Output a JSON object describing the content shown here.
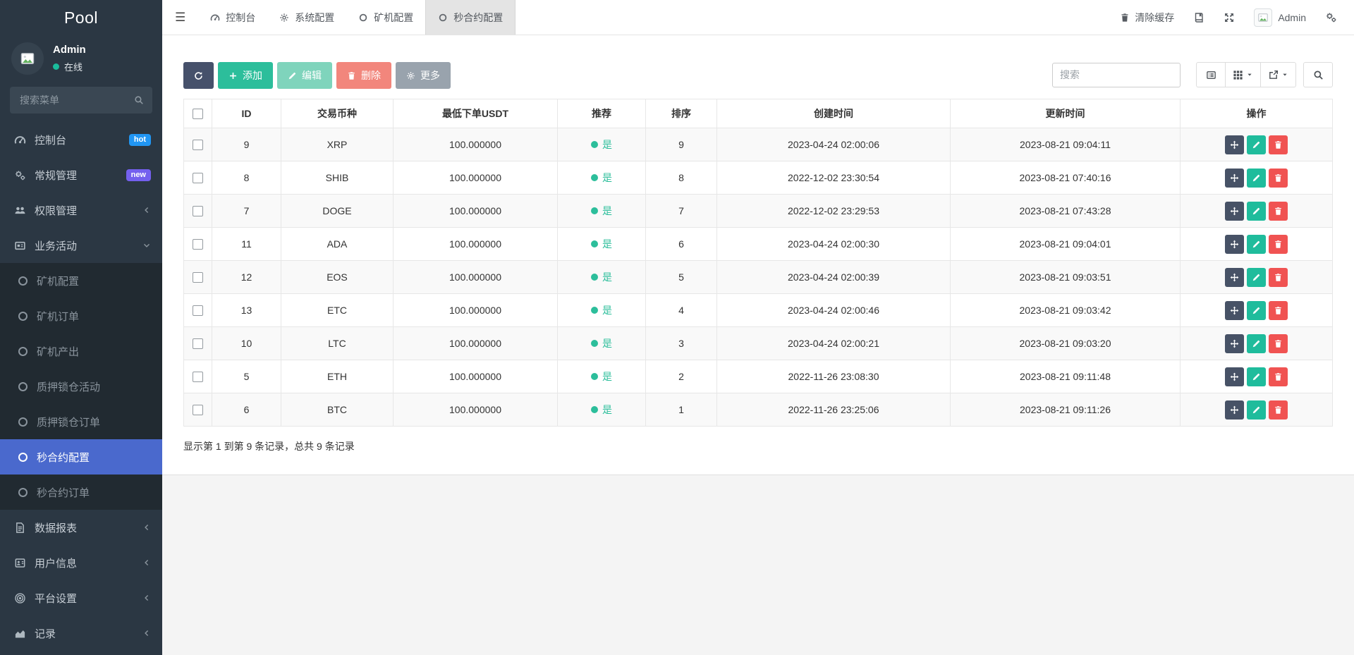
{
  "sidebar": {
    "logo": "Pool",
    "user": {
      "name": "Admin",
      "status": "在线",
      "status_color": "#1abc9c"
    },
    "search_placeholder": "搜索菜单",
    "menu_top": [
      {
        "label": "控制台",
        "icon": "gauge-icon",
        "badge": {
          "text": "hot",
          "color": "#2196f3"
        }
      },
      {
        "label": "常规管理",
        "icon": "cogs-icon",
        "badge": {
          "text": "new",
          "color": "#7460ee"
        }
      },
      {
        "label": "权限管理",
        "icon": "users-icon",
        "chevron": "left"
      },
      {
        "label": "业务活动",
        "icon": "newspaper-icon",
        "chevron": "down"
      }
    ],
    "submenu": {
      "items": [
        "矿机配置",
        "矿机订单",
        "矿机产出",
        "质押锁仓活动",
        "质押锁仓订单",
        "秒合约配置",
        "秒合约订单"
      ],
      "active": "秒合约配置",
      "active_color": "#4a69cd"
    },
    "menu_bottom": [
      {
        "label": "数据报表",
        "icon": "report-icon",
        "chevron": "left"
      },
      {
        "label": "用户信息",
        "icon": "address-book-icon",
        "chevron": "left"
      },
      {
        "label": "平台设置",
        "icon": "bullseye-icon",
        "chevron": "left"
      },
      {
        "label": "记录",
        "icon": "area-chart-icon",
        "chevron": "left"
      }
    ]
  },
  "topbar": {
    "tabs": [
      {
        "label": "控制台",
        "icon": "gauge-icon",
        "active": false
      },
      {
        "label": "系统配置",
        "icon": "gear-icon",
        "active": false
      },
      {
        "label": "矿机配置",
        "icon": "circle-icon",
        "active": false
      },
      {
        "label": "秒合约配置",
        "icon": "circle-icon",
        "active": true
      }
    ],
    "right": {
      "clear_cache": "清除缓存",
      "user": "Admin"
    }
  },
  "toolbar": {
    "add_label": "添加",
    "edit_label": "编辑",
    "delete_label": "删除",
    "more_label": "更多",
    "search_placeholder": "搜索"
  },
  "table": {
    "columns": [
      "ID",
      "交易币种",
      "最低下单USDT",
      "推荐",
      "排序",
      "创建时间",
      "更新时间",
      "操作"
    ],
    "rows": [
      {
        "id": "9",
        "coin": "XRP",
        "min_order_usdt": "100.000000",
        "recommend": "是",
        "sort": "9",
        "created_at": "2023-04-24 02:00:06",
        "updated_at": "2023-08-21 09:04:11"
      },
      {
        "id": "8",
        "coin": "SHIB",
        "min_order_usdt": "100.000000",
        "recommend": "是",
        "sort": "8",
        "created_at": "2022-12-02 23:30:54",
        "updated_at": "2023-08-21 07:40:16"
      },
      {
        "id": "7",
        "coin": "DOGE",
        "min_order_usdt": "100.000000",
        "recommend": "是",
        "sort": "7",
        "created_at": "2022-12-02 23:29:53",
        "updated_at": "2023-08-21 07:43:28"
      },
      {
        "id": "11",
        "coin": "ADA",
        "min_order_usdt": "100.000000",
        "recommend": "是",
        "sort": "6",
        "created_at": "2023-04-24 02:00:30",
        "updated_at": "2023-08-21 09:04:01"
      },
      {
        "id": "12",
        "coin": "EOS",
        "min_order_usdt": "100.000000",
        "recommend": "是",
        "sort": "5",
        "created_at": "2023-04-24 02:00:39",
        "updated_at": "2023-08-21 09:03:51"
      },
      {
        "id": "13",
        "coin": "ETC",
        "min_order_usdt": "100.000000",
        "recommend": "是",
        "sort": "4",
        "created_at": "2023-04-24 02:00:46",
        "updated_at": "2023-08-21 09:03:42"
      },
      {
        "id": "10",
        "coin": "LTC",
        "min_order_usdt": "100.000000",
        "recommend": "是",
        "sort": "3",
        "created_at": "2023-04-24 02:00:21",
        "updated_at": "2023-08-21 09:03:20"
      },
      {
        "id": "5",
        "coin": "ETH",
        "min_order_usdt": "100.000000",
        "recommend": "是",
        "sort": "2",
        "created_at": "2022-11-26 23:08:30",
        "updated_at": "2023-08-21 09:11:48"
      },
      {
        "id": "6",
        "coin": "BTC",
        "min_order_usdt": "100.000000",
        "recommend": "是",
        "sort": "1",
        "created_at": "2022-11-26 23:25:06",
        "updated_at": "2023-08-21 09:11:26"
      }
    ]
  },
  "footer": {
    "summary": "显示第 1 到第 9 条记录，总共 9 条记录"
  },
  "colors": {
    "accent_green": "#2cbe9b",
    "accent_red": "#f05352",
    "dark_button": "#475266",
    "sidebar_bg": "#2b3743",
    "sidebar_active": "#4a69cd",
    "badge_hot": "#2196f3",
    "badge_new": "#7460ee"
  }
}
